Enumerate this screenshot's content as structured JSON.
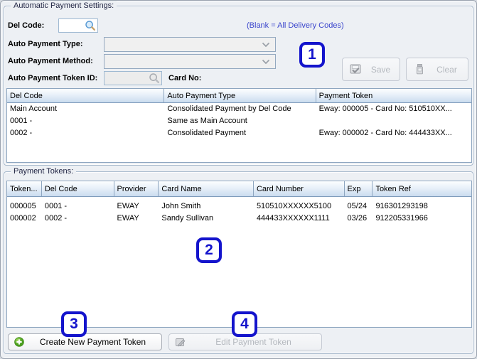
{
  "settings": {
    "title": "Automatic Payment Settings:",
    "fields": {
      "del_code_label": "Del Code:",
      "del_code_value": "",
      "blank_note": "(Blank = All Delivery Codes)",
      "type_label": "Auto Payment Type:",
      "type_value": "",
      "method_label": "Auto Payment Method:",
      "method_value": "",
      "token_id_label": "Auto Payment Token ID:",
      "token_id_value": "",
      "card_no_label": "Card No:",
      "card_no_value": ""
    },
    "buttons": {
      "save": "Save",
      "clear": "Clear"
    },
    "table": {
      "columns": [
        "Del Code",
        "Auto Payment Type",
        "Payment Token"
      ],
      "rows": [
        [
          "Main Account",
          "Consolidated Payment by Del Code",
          "Eway: 000005 - Card No: 510510XX..."
        ],
        [
          "0001 -",
          "Same as Main Account",
          ""
        ],
        [
          "0002 -",
          "Consolidated Payment",
          "Eway: 000002 - Card No: 444433XX..."
        ]
      ]
    }
  },
  "tokens": {
    "title": "Payment Tokens:",
    "table": {
      "columns": [
        "Token...",
        "Del Code",
        "Provider",
        "Card Name",
        "Card Number",
        "Exp",
        "Token Ref"
      ],
      "rows": [
        [
          "000005",
          "0001 -",
          "EWAY",
          "John Smith",
          "510510XXXXXX5100",
          "05/24",
          "916301293198"
        ],
        [
          "000002",
          "0002 -",
          "EWAY",
          "Sandy Sullivan",
          "444433XXXXXX1111",
          "03/26",
          "912205331966"
        ]
      ]
    },
    "buttons": {
      "create": "Create New Payment Token",
      "edit": "Edit Payment Token"
    }
  },
  "annotations": [
    "1",
    "2",
    "3",
    "4"
  ],
  "icons": {
    "del_code_search": "search-icon",
    "token_id_search": "search-icon-disabled",
    "type_dropdown": "chevron-down-icon",
    "method_dropdown": "chevron-down-icon",
    "save": "save-disk-icon",
    "clear": "eraser-icon",
    "create": "green-plus-icon",
    "edit": "edit-pencil-icon"
  },
  "colors": {
    "annotation_blue": "#1414cc",
    "note_blue": "#3a45cc",
    "group_border": "#a9bacd",
    "grid_header_top": "#fcfeff",
    "grid_header_bottom": "#cadcef",
    "panel_bg": "#edf0f4"
  }
}
